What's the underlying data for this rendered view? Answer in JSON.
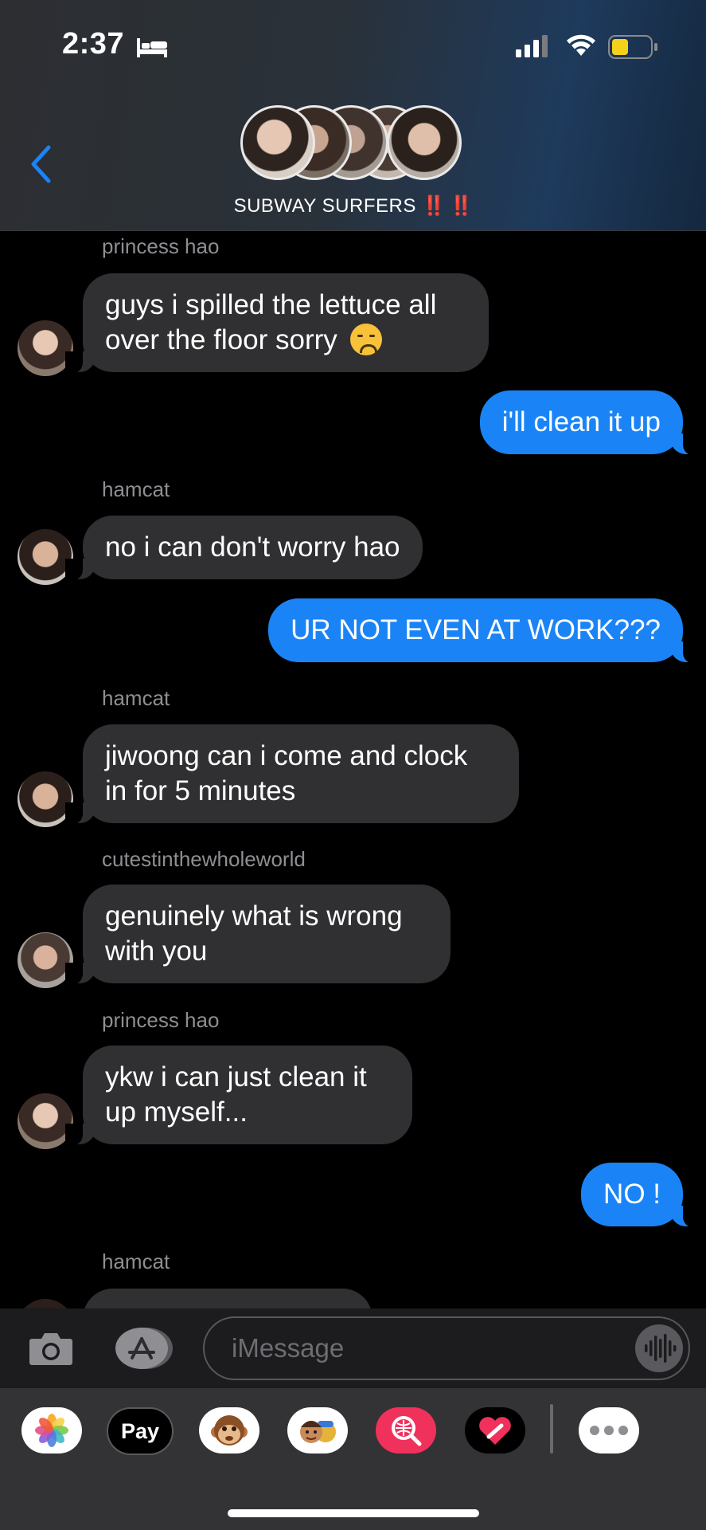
{
  "status_bar": {
    "time": "2:37"
  },
  "header": {
    "group_name": "SUBWAY SURFERS",
    "group_emoji": "‼️ ‼️",
    "back_icon": "chevron-left-icon",
    "accent": "#1a84f7"
  },
  "messages": [
    {
      "type": "in",
      "sender": "princess hao",
      "text": "guys i spilled the lettuce all over the floor sorry",
      "emoji": "disappointed-face"
    },
    {
      "type": "out",
      "text": "i'll clean it up"
    },
    {
      "type": "in",
      "sender": "hamcat",
      "text": "no i can don't worry hao"
    },
    {
      "type": "out",
      "text": "UR NOT EVEN AT WORK???"
    },
    {
      "type": "in",
      "sender": "hamcat",
      "text": "jiwoong can i come and clock in for 5 minutes"
    },
    {
      "type": "in",
      "sender": "cutestinthewholeworld",
      "text": "genuinely what is wrong with you"
    },
    {
      "type": "in",
      "sender": "princess hao",
      "text": "ykw i can just clean it up myself..."
    },
    {
      "type": "out",
      "text": "NO !"
    },
    {
      "type": "in",
      "sender": "hamcat",
      "text": ""
    }
  ],
  "input": {
    "placeholder": "iMessage"
  },
  "apps": {
    "items": [
      "photos-icon",
      "apple-pay-icon",
      "monkey-memoji-icon",
      "memoji-icon",
      "image-search-icon",
      "digital-touch-icon",
      "more-icon"
    ],
    "pay_label": "Pay"
  },
  "colors": {
    "incoming": "#303032",
    "outgoing": "#1a84f7",
    "background": "#000000",
    "alert": "#e0262b"
  }
}
